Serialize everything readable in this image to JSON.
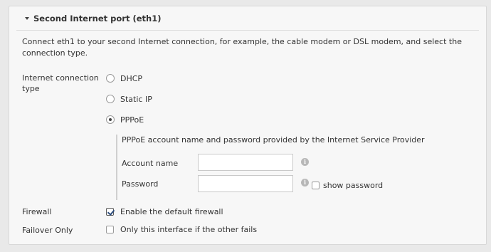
{
  "section": {
    "title": "Second Internet port (eth1)",
    "intro": "Connect eth1 to your second Internet connection, for example, the cable modem or DSL modem, and select the connection type."
  },
  "connection_type": {
    "label": "Internet connection type",
    "options": [
      {
        "label": "DHCP",
        "selected": false
      },
      {
        "label": "Static IP",
        "selected": false
      },
      {
        "label": "PPPoE",
        "selected": true
      }
    ]
  },
  "pppoe": {
    "description": "PPPoE account name and password provided by the Internet Service Provider",
    "account_label": "Account name",
    "account_value": "",
    "password_label": "Password",
    "password_value": "",
    "show_password_label": "show password",
    "show_password_checked": false
  },
  "firewall": {
    "label": "Firewall",
    "option_label": "Enable the default firewall",
    "checked": true
  },
  "failover": {
    "label": "Failover Only",
    "option_label": "Only this interface if the other fails",
    "checked": false
  }
}
